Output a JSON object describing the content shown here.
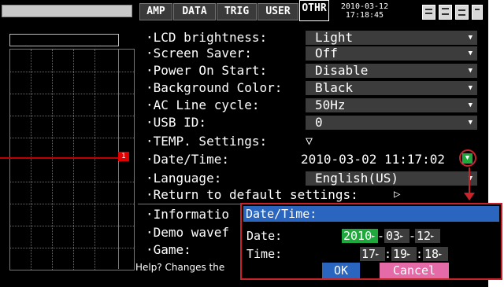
{
  "tabs": [
    {
      "label": "AMP"
    },
    {
      "label": "DATA"
    },
    {
      "label": "TRIG"
    },
    {
      "label": "USER"
    },
    {
      "label": "OTHR"
    }
  ],
  "header": {
    "date": "2010-03-12",
    "time": "17:18:45"
  },
  "icons": [
    "memory-icon",
    "save-icon",
    "copy-icon",
    "printer-icon"
  ],
  "channel_marker": "1",
  "settings": [
    {
      "label": "·LCD brightness:",
      "value": "Light"
    },
    {
      "label": "·Screen Saver:",
      "value": "Off"
    },
    {
      "label": "·Power On Start:",
      "value": "Disable"
    },
    {
      "label": "·Background Color:",
      "value": "Black"
    },
    {
      "label": "·AC Line cycle:",
      "value": "50Hz"
    },
    {
      "label": "·USB ID:",
      "value": "0"
    },
    {
      "label": "·TEMP. Settings:",
      "value": "▽"
    },
    {
      "label": "·Date/Time:",
      "value": "2010-03-02 11:17:02"
    },
    {
      "label": "·Language:",
      "value": "English(US)"
    },
    {
      "label": "·Return to default settings:",
      "value": "▷"
    }
  ],
  "lower_items": [
    {
      "label": "·Informatio"
    },
    {
      "label": "·Demo wavef"
    },
    {
      "label": "·Game:"
    }
  ],
  "help_text": "Help? Changes the",
  "popup": {
    "title": "Date/Time:",
    "date_label": "Date:",
    "time_label": "Time:",
    "year": "2010",
    "month": "03",
    "day": "12",
    "hour": "17",
    "minute": "19",
    "second": "18",
    "ok": "OK",
    "cancel": "Cancel"
  },
  "colors": {
    "tab_active_border": "#ffffff",
    "popup_title_bg": "#2a66c0",
    "selected_field_bg": "#1fa83c",
    "cancel_bg": "#e46aa8",
    "ok_bg": "#2a66c0",
    "callout": "#c8232b",
    "trace": "#c00000"
  }
}
